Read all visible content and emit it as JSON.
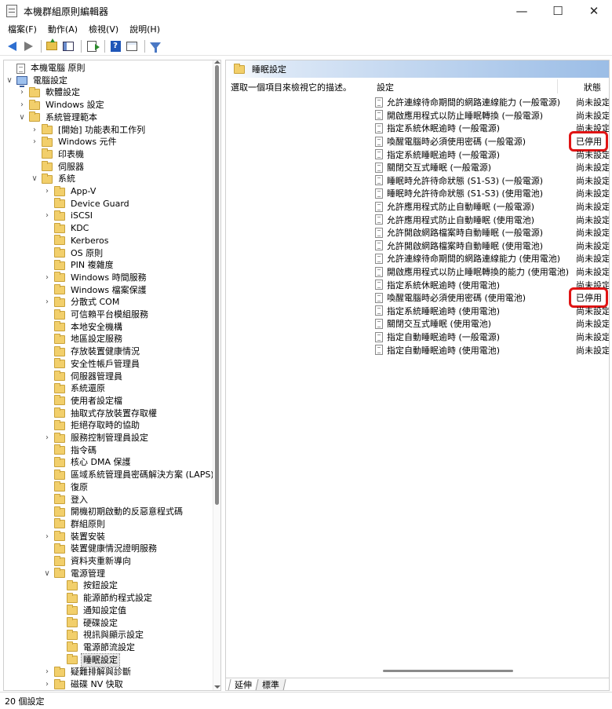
{
  "window": {
    "title": "本機群組原則編輯器"
  },
  "menu": [
    "檔案(F)",
    "動作(A)",
    "檢視(V)",
    "說明(H)"
  ],
  "tree": [
    {
      "label": "本機電腦 原則",
      "level": 0,
      "expander": "",
      "icon": "doc-icon"
    },
    {
      "label": "電腦設定",
      "level": 0,
      "expander": "expanded",
      "icon": "computer-icon"
    },
    {
      "label": "軟體設定",
      "level": 1,
      "expander": "collapsed",
      "icon": "folder-icon"
    },
    {
      "label": "Windows 設定",
      "level": 1,
      "expander": "collapsed",
      "icon": "folder-icon"
    },
    {
      "label": "系統管理範本",
      "level": 1,
      "expander": "expanded",
      "icon": "folder-icon"
    },
    {
      "label": "[開始] 功能表和工作列",
      "level": 2,
      "expander": "collapsed",
      "icon": "folder-icon"
    },
    {
      "label": "Windows 元件",
      "level": 2,
      "expander": "collapsed",
      "icon": "folder-icon"
    },
    {
      "label": "印表機",
      "level": 2,
      "expander": "",
      "icon": "folder-icon"
    },
    {
      "label": "伺服器",
      "level": 2,
      "expander": "",
      "icon": "folder-icon"
    },
    {
      "label": "系統",
      "level": 2,
      "expander": "expanded",
      "icon": "folder-icon"
    },
    {
      "label": "App-V",
      "level": 3,
      "expander": "collapsed",
      "icon": "folder-icon"
    },
    {
      "label": "Device Guard",
      "level": 3,
      "expander": "",
      "icon": "folder-icon"
    },
    {
      "label": "iSCSI",
      "level": 3,
      "expander": "collapsed",
      "icon": "folder-icon"
    },
    {
      "label": "KDC",
      "level": 3,
      "expander": "",
      "icon": "folder-icon"
    },
    {
      "label": "Kerberos",
      "level": 3,
      "expander": "",
      "icon": "folder-icon"
    },
    {
      "label": "OS 原則",
      "level": 3,
      "expander": "",
      "icon": "folder-icon"
    },
    {
      "label": "PIN 複雜度",
      "level": 3,
      "expander": "",
      "icon": "folder-icon"
    },
    {
      "label": "Windows 時間服務",
      "level": 3,
      "expander": "collapsed",
      "icon": "folder-icon"
    },
    {
      "label": "Windows 檔案保護",
      "level": 3,
      "expander": "",
      "icon": "folder-icon"
    },
    {
      "label": "分散式 COM",
      "level": 3,
      "expander": "collapsed",
      "icon": "folder-icon"
    },
    {
      "label": "可信賴平台模組服務",
      "level": 3,
      "expander": "",
      "icon": "folder-icon"
    },
    {
      "label": "本地安全機構",
      "level": 3,
      "expander": "",
      "icon": "folder-icon"
    },
    {
      "label": "地區設定服務",
      "level": 3,
      "expander": "",
      "icon": "folder-icon"
    },
    {
      "label": "存放裝置健康情況",
      "level": 3,
      "expander": "",
      "icon": "folder-icon"
    },
    {
      "label": "安全性帳戶管理員",
      "level": 3,
      "expander": "",
      "icon": "folder-icon"
    },
    {
      "label": "伺服器管理員",
      "level": 3,
      "expander": "",
      "icon": "folder-icon"
    },
    {
      "label": "系統還原",
      "level": 3,
      "expander": "",
      "icon": "folder-icon"
    },
    {
      "label": "使用者設定檔",
      "level": 3,
      "expander": "",
      "icon": "folder-icon"
    },
    {
      "label": "抽取式存放裝置存取權",
      "level": 3,
      "expander": "",
      "icon": "folder-icon"
    },
    {
      "label": "拒絕存取時的協助",
      "level": 3,
      "expander": "",
      "icon": "folder-icon"
    },
    {
      "label": "服務控制管理員設定",
      "level": 3,
      "expander": "collapsed",
      "icon": "folder-icon"
    },
    {
      "label": "指令碼",
      "level": 3,
      "expander": "",
      "icon": "folder-icon"
    },
    {
      "label": "核心 DMA 保護",
      "level": 3,
      "expander": "",
      "icon": "folder-icon"
    },
    {
      "label": "區域系統管理員密碼解決方案 (LAPS)",
      "level": 3,
      "expander": "",
      "icon": "folder-icon"
    },
    {
      "label": "復原",
      "level": 3,
      "expander": "",
      "icon": "folder-icon"
    },
    {
      "label": "登入",
      "level": 3,
      "expander": "",
      "icon": "folder-icon"
    },
    {
      "label": "開機初期啟動的反惡意程式碼",
      "level": 3,
      "expander": "",
      "icon": "folder-icon"
    },
    {
      "label": "群組原則",
      "level": 3,
      "expander": "",
      "icon": "folder-icon"
    },
    {
      "label": "裝置安裝",
      "level": 3,
      "expander": "collapsed",
      "icon": "folder-icon"
    },
    {
      "label": "裝置健康情況證明服務",
      "level": 3,
      "expander": "",
      "icon": "folder-icon"
    },
    {
      "label": "資料夾重新導向",
      "level": 3,
      "expander": "",
      "icon": "folder-icon"
    },
    {
      "label": "電源管理",
      "level": 3,
      "expander": "expanded",
      "icon": "folder-icon"
    },
    {
      "label": "按鈕設定",
      "level": 4,
      "expander": "",
      "icon": "folder-icon"
    },
    {
      "label": "能源節約程式設定",
      "level": 4,
      "expander": "",
      "icon": "folder-icon"
    },
    {
      "label": "通知設定值",
      "level": 4,
      "expander": "",
      "icon": "folder-icon"
    },
    {
      "label": "硬碟設定",
      "level": 4,
      "expander": "",
      "icon": "folder-icon"
    },
    {
      "label": "視訊與顯示設定",
      "level": 4,
      "expander": "",
      "icon": "folder-icon"
    },
    {
      "label": "電源節流設定",
      "level": 4,
      "expander": "",
      "icon": "folder-icon"
    },
    {
      "label": "睡眠設定",
      "level": 4,
      "expander": "",
      "icon": "folder-icon",
      "selected": true
    },
    {
      "label": "疑難排解與診斷",
      "level": 3,
      "expander": "collapsed",
      "icon": "folder-icon"
    },
    {
      "label": "磁碟 NV 快取",
      "level": 3,
      "expander": "collapsed",
      "icon": "folder-icon"
    }
  ],
  "right": {
    "header_title": "睡眠設定",
    "description": "選取一個項目來檢視它的描述。",
    "col_setting": "設定",
    "col_state": "狀態",
    "rows": [
      {
        "name": "允許連線待命期間的網路連線能力 (一般電源)",
        "state": "尚未設定"
      },
      {
        "name": "開啟應用程式以防止睡眠轉換 (一般電源)",
        "state": "尚未設定"
      },
      {
        "name": "指定系統休眠逾時 (一般電源)",
        "state": "尚未設定"
      },
      {
        "name": "喚醒電腦時必須使用密碼 (一般電源)",
        "state": "已停用",
        "highlight": true
      },
      {
        "name": "指定系統睡眠逾時 (一般電源)",
        "state": "尚未設定"
      },
      {
        "name": "關閉交互式睡眠 (一般電源)",
        "state": "尚未設定"
      },
      {
        "name": "睡眠時允許待命狀態 (S1-S3) (一般電源)",
        "state": "尚未設定"
      },
      {
        "name": "睡眠時允許待命狀態 (S1-S3) (使用電池)",
        "state": "尚未設定"
      },
      {
        "name": "允許應用程式防止自動睡眠 (一般電源)",
        "state": "尚未設定"
      },
      {
        "name": "允許應用程式防止自動睡眠 (使用電池)",
        "state": "尚未設定"
      },
      {
        "name": "允許開啟網路檔案時自動睡眠 (一般電源)",
        "state": "尚未設定"
      },
      {
        "name": "允許開啟網路檔案時自動睡眠 (使用電池)",
        "state": "尚未設定"
      },
      {
        "name": "允許連線待命期間的網路連線能力 (使用電池)",
        "state": "尚未設定"
      },
      {
        "name": "開啟應用程式以防止睡眠轉換的能力 (使用電池)",
        "state": "尚未設定"
      },
      {
        "name": "指定系統休眠逾時 (使用電池)",
        "state": "尚未設定"
      },
      {
        "name": "喚醒電腦時必須使用密碼 (使用電池)",
        "state": "已停用",
        "highlight": true
      },
      {
        "name": "指定系統睡眠逾時 (使用電池)",
        "state": "尚未設定"
      },
      {
        "name": "關閉交互式睡眠 (使用電池)",
        "state": "尚未設定"
      },
      {
        "name": "指定自動睡眠逾時 (一般電源)",
        "state": "尚未設定"
      },
      {
        "name": "指定自動睡眠逾時 (使用電池)",
        "state": "尚未設定"
      }
    ],
    "tabs": [
      "延伸",
      "標準"
    ],
    "active_tab": 0
  },
  "status": "20 個設定",
  "colors": {
    "highlight": "#e01414",
    "header_gradient": "#9bbde6"
  }
}
